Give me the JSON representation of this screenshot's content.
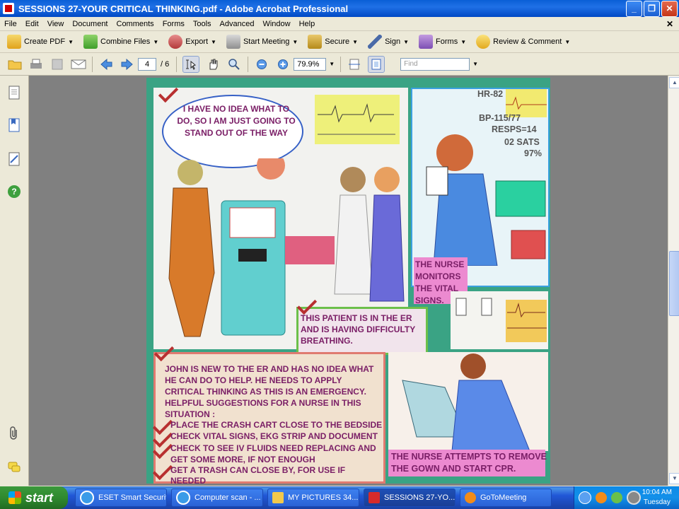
{
  "window": {
    "title": "SESSIONS 27-YOUR CRITICAL THINKING.pdf - Adobe Acrobat Professional",
    "minimize": "_",
    "maximize": "❐",
    "close": "✕"
  },
  "menu": {
    "items": [
      "File",
      "Edit",
      "View",
      "Document",
      "Comments",
      "Forms",
      "Tools",
      "Advanced",
      "Window",
      "Help"
    ],
    "close_doc": "✕"
  },
  "toolbar1": {
    "create_pdf": "Create PDF",
    "combine_files": "Combine Files",
    "export": "Export",
    "start_meeting": "Start Meeting",
    "secure": "Secure",
    "sign": "Sign",
    "forms": "Forms",
    "review_comment": "Review & Comment"
  },
  "toolbar2": {
    "current_page": "4",
    "total_pages": "/ 6",
    "zoom": "79.9%",
    "find_placeholder": "Find"
  },
  "comic": {
    "bubble_text": "I HAVE NO IDEA WHAT TO DO, SO I AM JUST GOING TO STAND OUT OF THE WAY",
    "vitals": {
      "hr": "HR-82",
      "bp": "BP-115/77",
      "resps": "RESPS=14",
      "o2": "02 SATS",
      "o2_value": "97%"
    },
    "nurse_monitors": "THE NURSE MONITORS THE VITAL SIGNS.",
    "patient_caption": "THIS PATIENT IS IN THE ER AND IS HAVING DIFFICULTY BREATHING.",
    "main_text": {
      "intro": "JOHN IS NEW TO THE ER AND HAS NO IDEA WHAT HE CAN DO TO HELP. HE NEEDS TO APPLY CRITICAL THINKING AS THIS IS AN EMERGENCY. HELPFUL SUGGESTIONS FOR A NURSE  IN THIS SITUATION :",
      "items": [
        "PLACE THE CRASH CART CLOSE TO THE BEDSIDE",
        "CHECK VITAL SIGNS, EKG STRIP AND DOCUMENT",
        "CHECK TO SEE IV FLUIDS NEED REPLACING AND GET SOME MORE, IF NOT ENOUGH",
        "GET A TRASH CAN CLOSE BY, FOR USE IF NEEDED"
      ]
    },
    "cpr_caption": "THE NURSE ATTEMPTS TO REMOVE THE GOWN AND START CPR."
  },
  "taskbar": {
    "start": "start",
    "tasks": [
      {
        "label": "ESET Smart Security",
        "color": "#3a9be8"
      },
      {
        "label": "Computer scan - ...",
        "color": "#3a9be8"
      },
      {
        "label": "MY PICTURES 34...",
        "color": "#f2c94c"
      },
      {
        "label": "SESSIONS 27-YO...",
        "color": "#d62b2b"
      },
      {
        "label": "GoToMeeting",
        "color": "#f28c1a"
      }
    ],
    "time": "10:04 AM",
    "day": "Tuesday"
  }
}
